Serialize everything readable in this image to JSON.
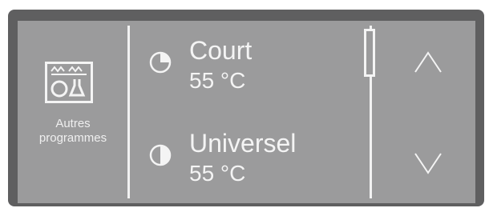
{
  "sidebar": {
    "icon": "dishes-rack-icon",
    "label_line1": "Autres",
    "label_line2": "programmes"
  },
  "programs": [
    {
      "name": "Court",
      "temperature": "55 °C",
      "icon": "short-timer-icon"
    },
    {
      "name": "Universel",
      "temperature": "55 °C",
      "icon": "universal-timer-icon"
    }
  ],
  "navigation": {
    "up_icon": "chevron-up-icon",
    "down_icon": "chevron-down-icon"
  },
  "colors": {
    "bezel": "#5f5f60",
    "screen": "#9b9b9c",
    "foreground": "#f4f4f4"
  }
}
